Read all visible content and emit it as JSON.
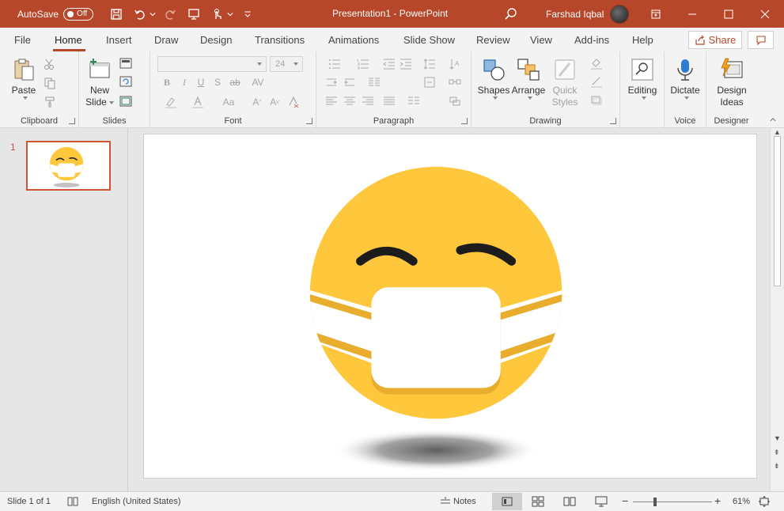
{
  "titlebar": {
    "autosave_label": "AutoSave",
    "autosave_state": "Off",
    "document_title": "Presentation1  -  PowerPoint",
    "user_name": "Farshad Iqbal"
  },
  "tabs": [
    "File",
    "Home",
    "Insert",
    "Draw",
    "Design",
    "Transitions",
    "Animations",
    "Slide Show",
    "Review",
    "View",
    "Add-ins",
    "Help"
  ],
  "active_tab": "Home",
  "share_label": "Share",
  "ribbon": {
    "clipboard": {
      "label": "Clipboard",
      "paste": "Paste"
    },
    "slides": {
      "label": "Slides",
      "new_slide_line1": "New",
      "new_slide_line2": "Slide"
    },
    "font": {
      "label": "Font",
      "font_size": "24"
    },
    "paragraph": {
      "label": "Paragraph"
    },
    "drawing": {
      "label": "Drawing",
      "shapes": "Shapes",
      "arrange": "Arrange",
      "quick_styles_line1": "Quick",
      "quick_styles_line2": "Styles"
    },
    "editing": {
      "label": "Editing"
    },
    "voice": {
      "label": "Voice",
      "dictate": "Dictate"
    },
    "designer": {
      "label": "Designer",
      "design_ideas_line1": "Design",
      "design_ideas_line2": "Ideas"
    }
  },
  "thumbnails": [
    {
      "number": "1"
    }
  ],
  "statusbar": {
    "slide_info": "Slide 1 of 1",
    "language": "English (United States)",
    "notes": "Notes",
    "zoom": "61%"
  },
  "colors": {
    "accent": "#b7472a",
    "emoji_yellow": "#fec73c",
    "emoji_band": "#e8ad2c"
  }
}
